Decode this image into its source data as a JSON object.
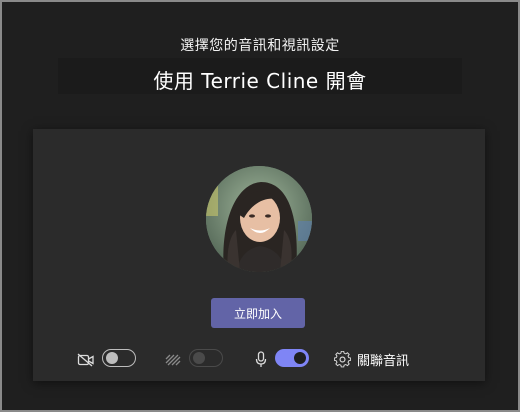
{
  "prejoin": {
    "subtitle": "選擇您的音訊和視訊設定",
    "title": "使用 Terrie Cline 開會"
  },
  "panel": {
    "avatar_alt": "participant photo",
    "join_label": "立即加入",
    "controls": {
      "camera": {
        "icon": "camera-off-icon",
        "state": "off"
      },
      "background_effects": {
        "icon": "background-blur-icon",
        "state": "disabled"
      },
      "microphone": {
        "icon": "microphone-icon",
        "state": "on"
      },
      "device_settings": {
        "icon": "gear-icon",
        "label": "關聯音訊"
      }
    }
  },
  "colors": {
    "background": "#1f1f1f",
    "panel": "#2b2b2b",
    "accent": "#6264a7",
    "toggle_on": "#7f85f5"
  }
}
